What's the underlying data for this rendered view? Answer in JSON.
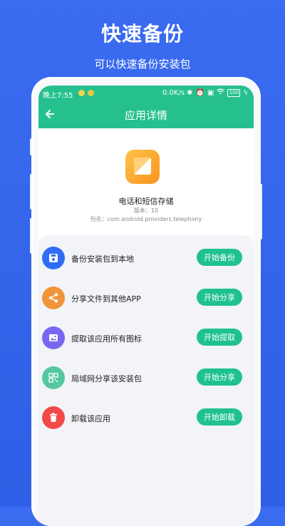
{
  "promo": {
    "title": "快速备份",
    "subtitle": "可以快速备份安装包"
  },
  "statusbar": {
    "time": "晚上7:55",
    "speed": "0.0K/s",
    "battery": "100",
    "accent": "#26c08f"
  },
  "appbar": {
    "title": "应用详情"
  },
  "app": {
    "name": "电话和短信存储",
    "version": "版本：10",
    "package": "包名：com.android.providers.telephony"
  },
  "actions": [
    {
      "label": "备份安装包到本地",
      "button": "开始备份",
      "icon": "save-icon",
      "color": "#2f6df5"
    },
    {
      "label": "分享文件到其他APP",
      "button": "开始分享",
      "icon": "share-icon",
      "color": "#f2943a"
    },
    {
      "label": "提取该应用所有图标",
      "button": "开始提取",
      "icon": "image-icon",
      "color": "#7867f0"
    },
    {
      "label": "局域网分享该安装包",
      "button": "开始分享",
      "icon": "qr-icon",
      "color": "#56c8a1"
    },
    {
      "label": "卸载该应用",
      "button": "开始卸载",
      "icon": "trash-icon",
      "color": "#f24949"
    }
  ]
}
